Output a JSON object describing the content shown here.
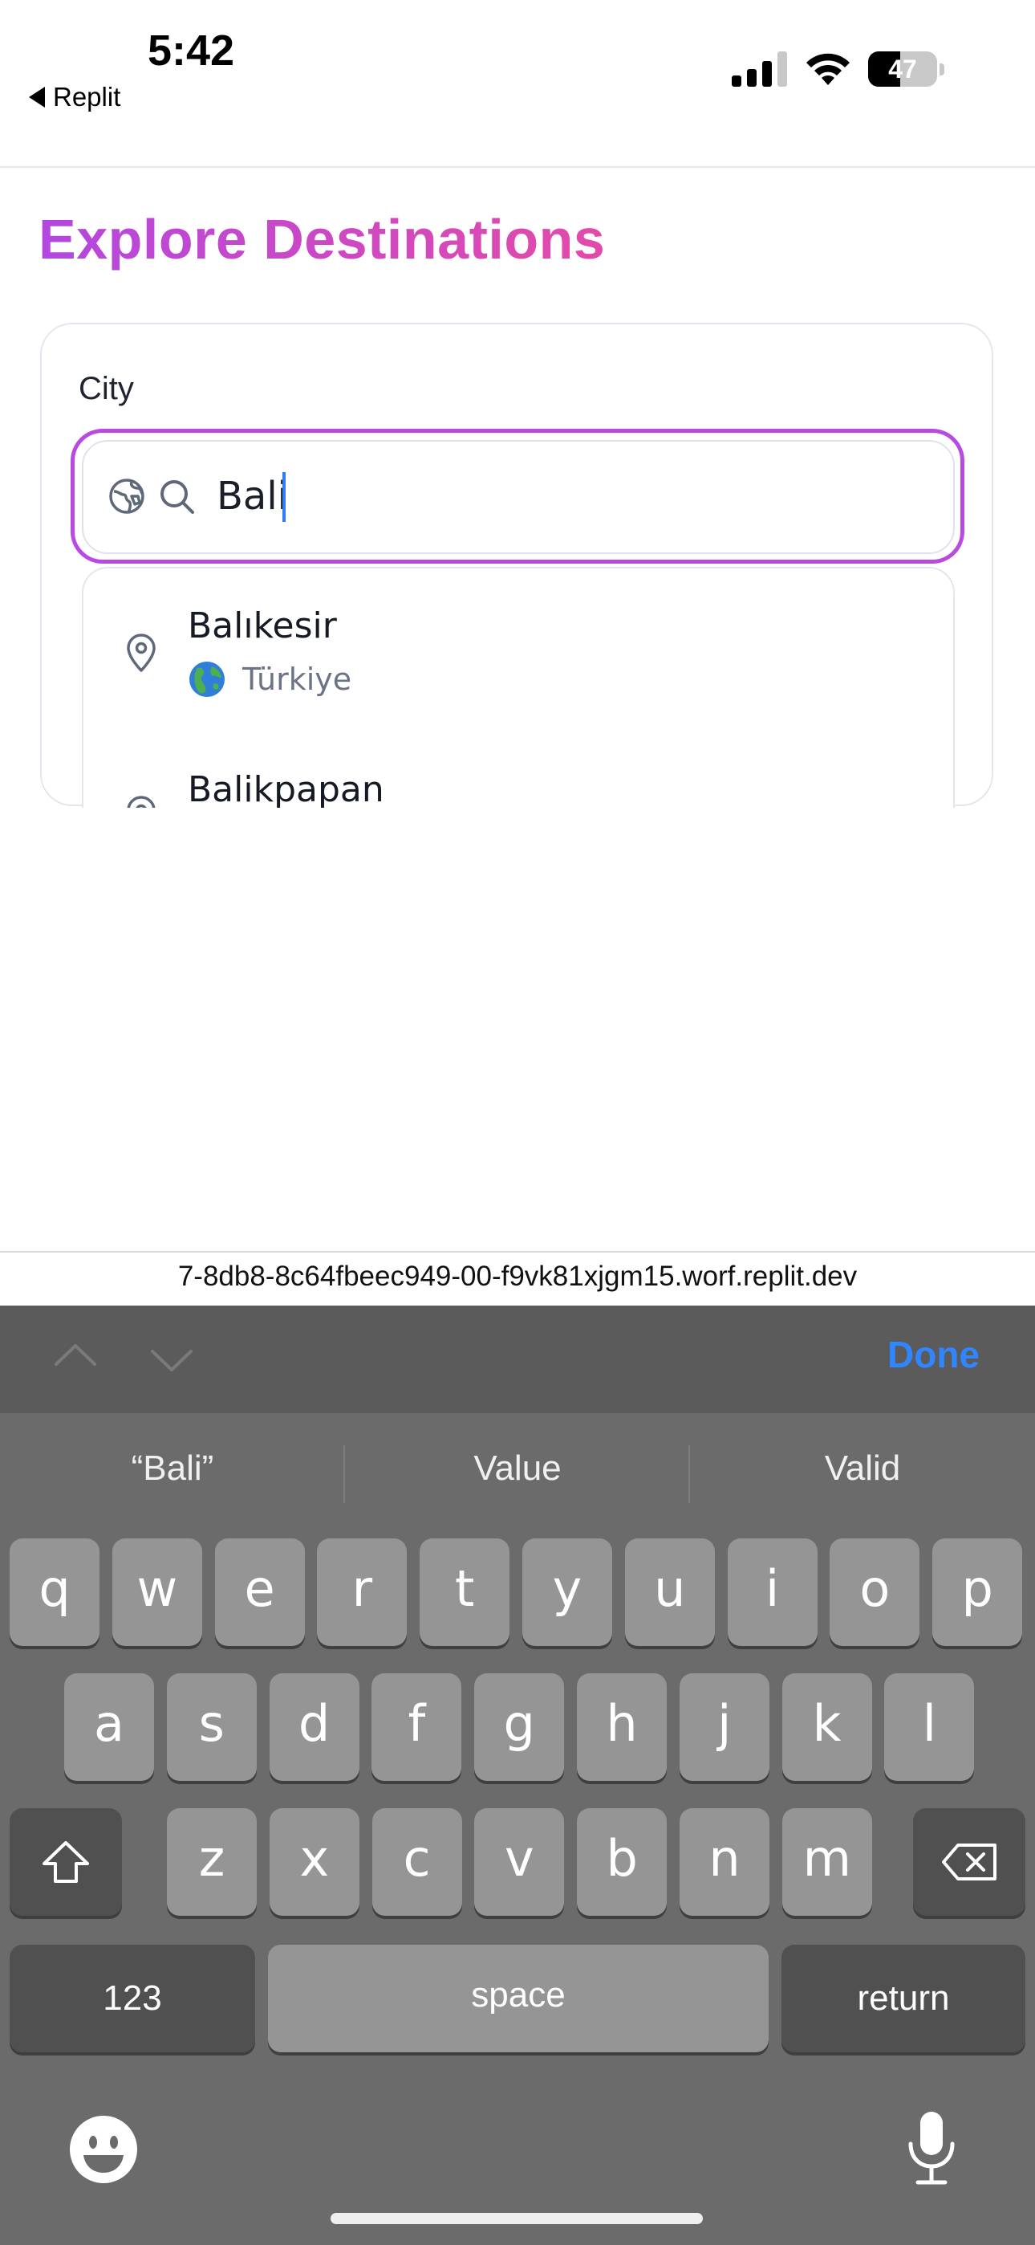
{
  "status": {
    "time": "5:42",
    "back_app": "Replit",
    "battery": "47",
    "battery_level": 0.47
  },
  "page": {
    "title": "Explore Destinations",
    "city_label": "City",
    "search_value": "Bali",
    "suggestions": [
      {
        "name": "Balıkesir",
        "country": "Türkiye",
        "icon": "map-pin-icon",
        "flag": "globe-emoji"
      },
      {
        "name": "Balikpapan",
        "country": "",
        "icon": "map-pin-icon"
      }
    ]
  },
  "browser": {
    "url": "7-8db8-8c64fbeec949-00-f9vk81xjgm15.worf.replit.dev"
  },
  "keyboard": {
    "done_label": "Done",
    "suggestions": [
      "“Bali”",
      "Value",
      "Valid"
    ],
    "row1": [
      "q",
      "w",
      "e",
      "r",
      "t",
      "y",
      "u",
      "i",
      "o",
      "p"
    ],
    "row2": [
      "a",
      "s",
      "d",
      "f",
      "g",
      "h",
      "j",
      "k",
      "l"
    ],
    "row3": [
      "z",
      "x",
      "c",
      "v",
      "b",
      "n",
      "m"
    ],
    "numbers_label": "123",
    "space_label": "space",
    "return_label": "return"
  },
  "colors": {
    "accent": "#b84ae2",
    "title_gradient_start": "#b347e0",
    "title_gradient_end": "#e34aa8",
    "done_blue": "#2f86ff",
    "caret_blue": "#2f7ef5"
  }
}
